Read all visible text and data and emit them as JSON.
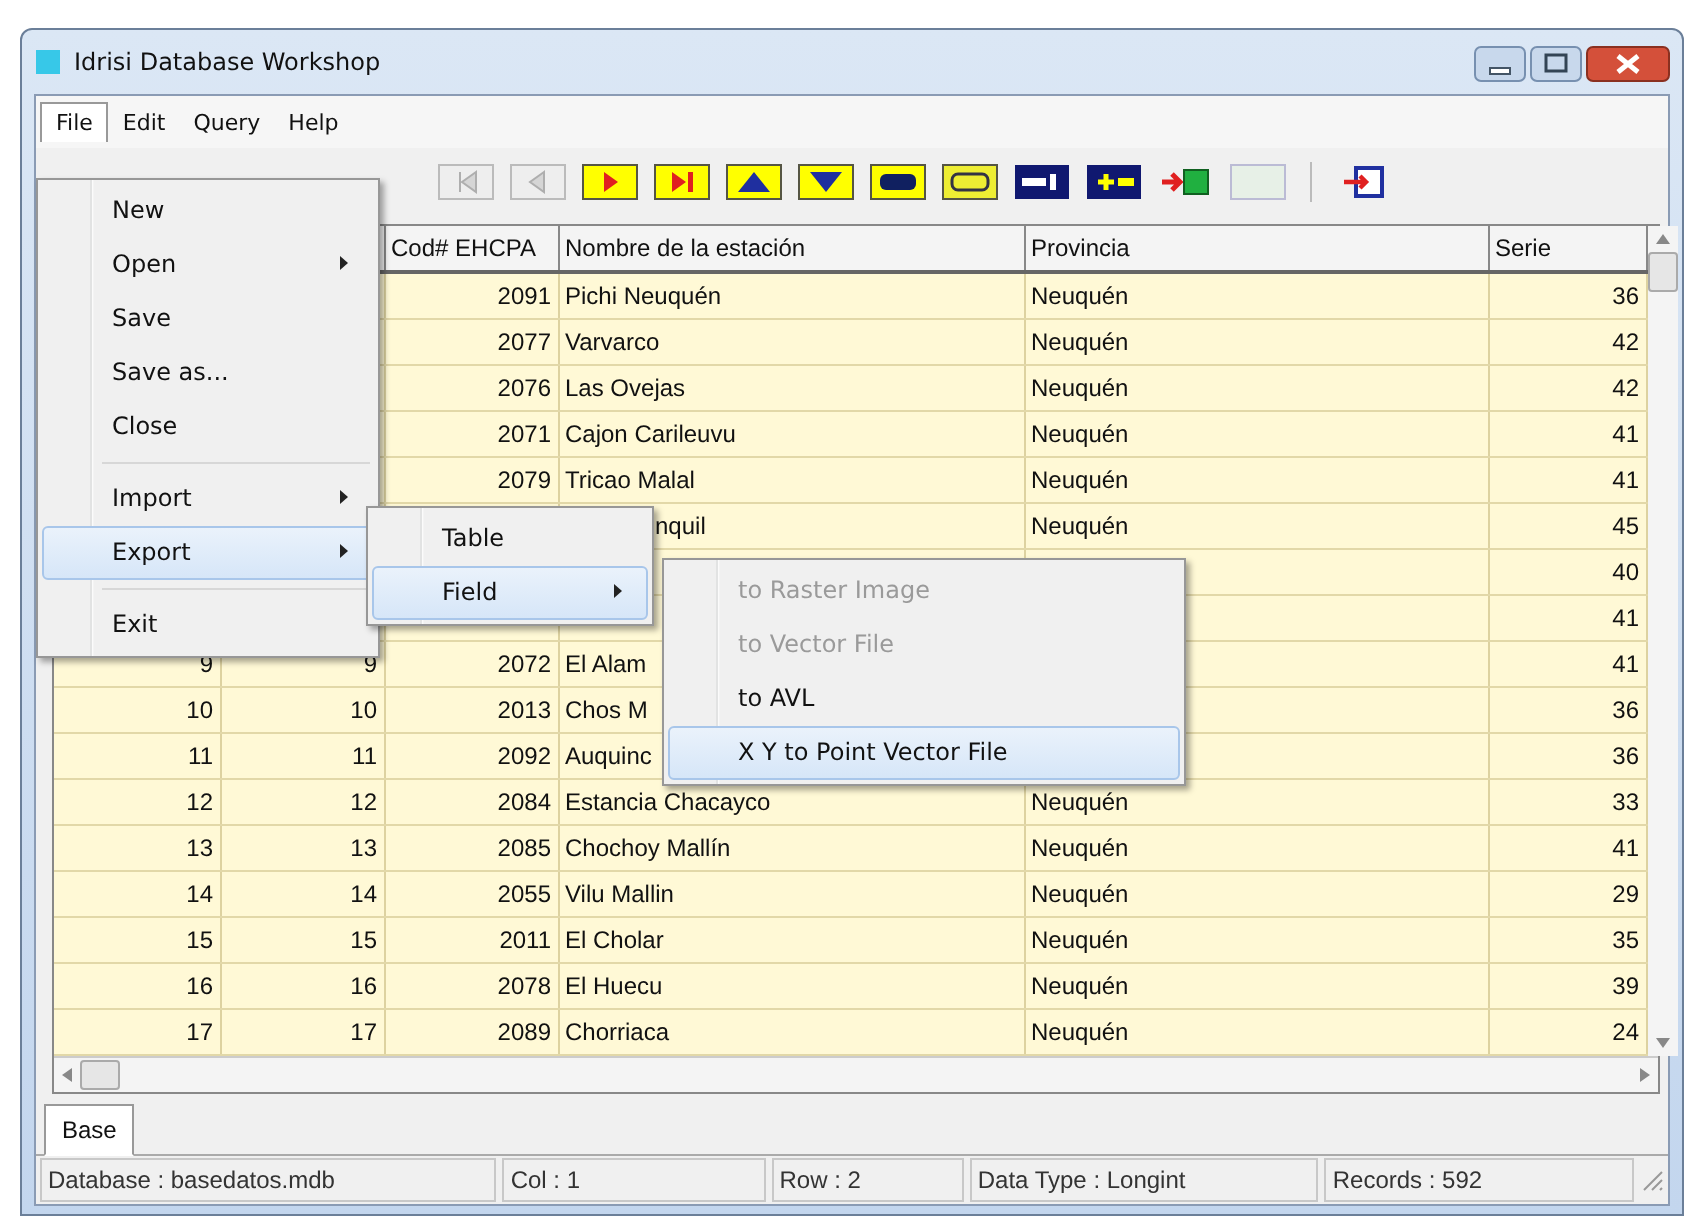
{
  "window": {
    "title": "Idrisi Database Workshop"
  },
  "menu_bar": [
    {
      "label": "File",
      "selected": true
    },
    {
      "label": "Edit",
      "selected": false
    },
    {
      "label": "Query",
      "selected": false
    },
    {
      "label": "Help",
      "selected": false
    }
  ],
  "toolbar": [
    {
      "kind": "first",
      "disabled": true
    },
    {
      "kind": "previous",
      "disabled": true
    },
    {
      "kind": "next",
      "disabled": false
    },
    {
      "kind": "last",
      "disabled": false
    },
    {
      "kind": "up",
      "disabled": false
    },
    {
      "kind": "down",
      "disabled": false
    },
    {
      "kind": "goggles",
      "disabled": false
    },
    {
      "kind": "goggles_outline",
      "disabled": false
    },
    {
      "kind": "remove_field",
      "disabled": false
    },
    {
      "kind": "add_field",
      "disabled": false
    },
    {
      "kind": "import",
      "disabled": false
    },
    {
      "kind": "blank",
      "disabled": true
    },
    {
      "kind": "separator"
    },
    {
      "kind": "exit",
      "disabled": false
    }
  ],
  "file_menu": [
    {
      "kind": "item",
      "label": "New",
      "submenu": false,
      "selected": false
    },
    {
      "kind": "item",
      "label": "Open",
      "submenu": true,
      "selected": false
    },
    {
      "kind": "item",
      "label": "Save",
      "submenu": false,
      "selected": false
    },
    {
      "kind": "item",
      "label": "Save as...",
      "submenu": false,
      "selected": false
    },
    {
      "kind": "item",
      "label": "Close",
      "submenu": false,
      "selected": false
    },
    {
      "kind": "separator"
    },
    {
      "kind": "item",
      "label": "Import",
      "submenu": true,
      "selected": false
    },
    {
      "kind": "item",
      "label": "Export",
      "submenu": true,
      "selected": true
    },
    {
      "kind": "separator"
    },
    {
      "kind": "item",
      "label": "Exit",
      "submenu": false,
      "selected": false
    }
  ],
  "export_submenu": [
    {
      "label": "Table",
      "submenu": false,
      "selected": false
    },
    {
      "label": "Field",
      "submenu": true,
      "selected": true
    }
  ],
  "field_submenu": [
    {
      "label": "to Raster Image",
      "disabled": true,
      "selected": false
    },
    {
      "label": "to Vector File",
      "disabled": true,
      "selected": false
    },
    {
      "label": "to AVL",
      "disabled": false,
      "selected": false
    },
    {
      "label": "X Y to Point Vector File",
      "disabled": false,
      "selected": true
    }
  ],
  "table": {
    "columns": [
      "Cod# EHCPA",
      "Nombre de la estación",
      "Provincia",
      "Serie"
    ],
    "rows": [
      {
        "cod": "2091",
        "name": "Pichi Neuquén",
        "provincia": "Neuquén",
        "serie": "36"
      },
      {
        "cod": "2077",
        "name": "Varvarco",
        "provincia": "Neuquén",
        "serie": "42"
      },
      {
        "cod": "2076",
        "name": "Las Ovejas",
        "provincia": "Neuquén",
        "serie": "42"
      },
      {
        "cod": "2071",
        "name": "Cajon Carileuvu",
        "provincia": "Neuquén",
        "serie": "41"
      },
      {
        "cod": "2079",
        "name": "Tricao Malal",
        "provincia": "Neuquén",
        "serie": "41"
      },
      {
        "name": "nquil",
        "name_cut": true,
        "provincia": "Neuquén",
        "serie": "45"
      },
      {
        "serie": "40"
      },
      {
        "serie": "41"
      },
      {
        "col_1": "9",
        "col_2": "9",
        "cod": "2072",
        "name": "El Alam",
        "serie": "41"
      },
      {
        "col_1": "10",
        "col_2": "10",
        "cod": "2013",
        "name": "Chos M",
        "serie": "36"
      },
      {
        "col_1": "11",
        "col_2": "11",
        "cod": "2092",
        "name": "Auquinc",
        "serie": "36"
      },
      {
        "col_1": "12",
        "col_2": "12",
        "cod": "2084",
        "name": "Estancia Chacayco",
        "provincia": "Neuquén",
        "serie": "33"
      },
      {
        "col_1": "13",
        "col_2": "13",
        "cod": "2085",
        "name": "Chochoy Mallín",
        "provincia": "Neuquén",
        "serie": "41"
      },
      {
        "col_1": "14",
        "col_2": "14",
        "cod": "2055",
        "name": "Vilu Mallin",
        "provincia": "Neuquén",
        "serie": "29"
      },
      {
        "col_1": "15",
        "col_2": "15",
        "cod": "2011",
        "name": "El Cholar",
        "provincia": "Neuquén",
        "serie": "35"
      },
      {
        "col_1": "16",
        "col_2": "16",
        "cod": "2078",
        "name": "El Huecu",
        "provincia": "Neuquén",
        "serie": "39"
      },
      {
        "col_1": "17",
        "col_2": "17",
        "cod": "2089",
        "name": "Chorriaca",
        "provincia": "Neuquén",
        "serie": "24"
      }
    ]
  },
  "tabs": [
    {
      "label": "Base",
      "selected": true
    }
  ],
  "status_bar": [
    "Database : basedatos.mdb",
    "Col : 1",
    "Row : 2",
    "Data Type : Longint",
    "Records : 592"
  ]
}
